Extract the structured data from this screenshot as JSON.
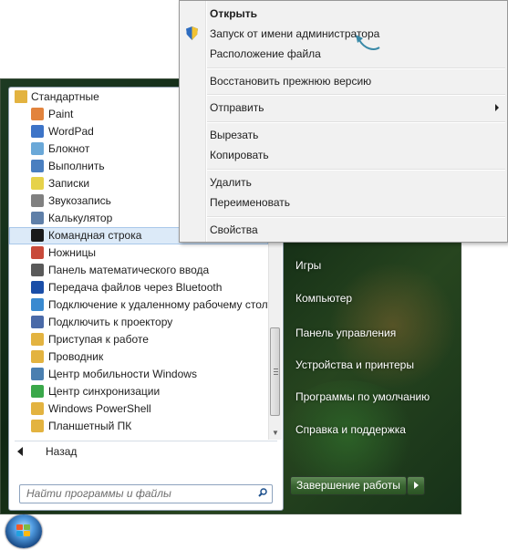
{
  "programs": {
    "folder_label": "Стандартные",
    "items": [
      {
        "label": "Paint",
        "icon": "paint-icon",
        "color": "#e2833d"
      },
      {
        "label": "WordPad",
        "icon": "wordpad-icon",
        "color": "#3d74c8"
      },
      {
        "label": "Блокнот",
        "icon": "notepad-icon",
        "color": "#6aa8d8"
      },
      {
        "label": "Выполнить",
        "icon": "run-icon",
        "color": "#4a7fc0"
      },
      {
        "label": "Записки",
        "icon": "sticky-notes-icon",
        "color": "#e6d24a"
      },
      {
        "label": "Звукозапись",
        "icon": "microphone-icon",
        "color": "#808080"
      },
      {
        "label": "Калькулятор",
        "icon": "calculator-icon",
        "color": "#5f7fa8"
      },
      {
        "label": "Командная строка",
        "icon": "cmd-icon",
        "color": "#1a1a1a",
        "selected": true
      },
      {
        "label": "Ножницы",
        "icon": "scissors-icon",
        "color": "#c84a3a"
      },
      {
        "label": "Панель математического ввода",
        "icon": "math-input-icon",
        "color": "#5a5a5a"
      },
      {
        "label": "Передача файлов через Bluetooth",
        "icon": "bluetooth-icon",
        "color": "#1a4ea8"
      },
      {
        "label": "Подключение к удаленному рабочему столу",
        "icon": "remote-desktop-icon",
        "color": "#3a8ad0"
      },
      {
        "label": "Подключить к проектору",
        "icon": "projector-icon",
        "color": "#4a6aa8"
      },
      {
        "label": "Приступая к работе",
        "icon": "getting-started-icon",
        "color": "#e3b340"
      },
      {
        "label": "Проводник",
        "icon": "explorer-icon",
        "color": "#e3b340"
      },
      {
        "label": "Центр мобильности Windows",
        "icon": "mobility-center-icon",
        "color": "#4a7fb0"
      },
      {
        "label": "Центр синхронизации",
        "icon": "sync-center-icon",
        "color": "#3aa84a"
      },
      {
        "label": "Windows PowerShell",
        "icon": "folder-icon",
        "color": "#e3b340"
      },
      {
        "label": "Планшетный ПК",
        "icon": "folder-icon",
        "color": "#e3b340"
      }
    ],
    "back_label": "Назад",
    "search_placeholder": "Найти программы и файлы"
  },
  "right_links": [
    "Игры",
    "Компьютер",
    "Панель управления",
    "Устройства и принтеры",
    "Программы по умолчанию",
    "Справка и поддержка"
  ],
  "shutdown_label": "Завершение работы",
  "context_menu": {
    "items": [
      {
        "label": "Открыть",
        "bold": true
      },
      {
        "label": "Запуск от имени администратора",
        "shield": true
      },
      {
        "label": "Расположение файла"
      },
      {
        "label": "Восстановить прежнюю версию"
      },
      {
        "label": "Отправить",
        "submenu": true
      },
      {
        "label": "Вырезать"
      },
      {
        "label": "Копировать"
      },
      {
        "label": "Удалить"
      },
      {
        "label": "Переименовать"
      },
      {
        "label": "Свойства"
      }
    ]
  },
  "colors": {
    "accent_selection": "#dceaf8",
    "menu_background": "#f1f1f1",
    "start_menu_green": "#1d3a22"
  }
}
